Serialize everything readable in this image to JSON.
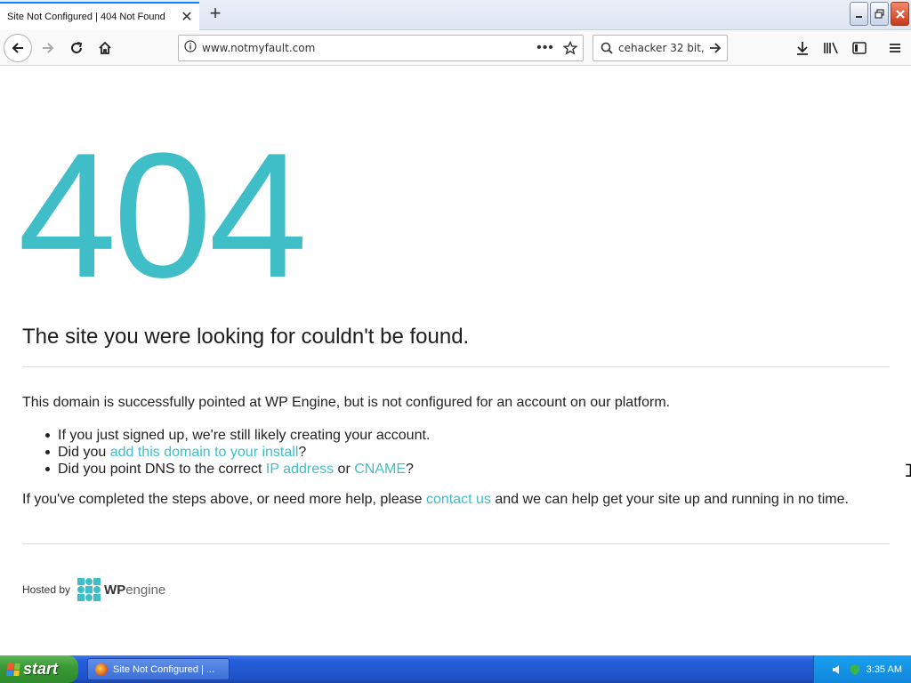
{
  "browser": {
    "tab_title": "Site Not Configured | 404 Not Found",
    "tab_close": "✕",
    "new_tab": "+",
    "url": "www.notmyfault.com",
    "search_query": "cehacker 32 bit,",
    "more_dots": "•••"
  },
  "page": {
    "code": "404",
    "headline": "The site you were looking for couldn't be found.",
    "intro": "This domain is successfully pointed at WP Engine, but is not configured for an account on our platform.",
    "bullet1": "If you just signed up, we're still likely creating your account.",
    "bullet2_pre": "Did you ",
    "bullet2_link": "add this domain to your install",
    "bullet2_post": "?",
    "bullet3_pre": "Did you point DNS to the correct ",
    "bullet3_link1": "IP address",
    "bullet3_mid": " or ",
    "bullet3_link2": "CNAME",
    "bullet3_post": "?",
    "help_pre": "If you've completed the steps above, or need more help, please ",
    "help_link": "contact us",
    "help_post": " and we can help get your site up and running in no time.",
    "hosted_by": "Hosted by",
    "logo_wp": "WP",
    "logo_engine": "engine",
    "accent_color": "#40bec7"
  },
  "taskbar": {
    "start_label": "start",
    "task_label": "Site Not Configured | ...",
    "clock": "3:35 AM"
  }
}
